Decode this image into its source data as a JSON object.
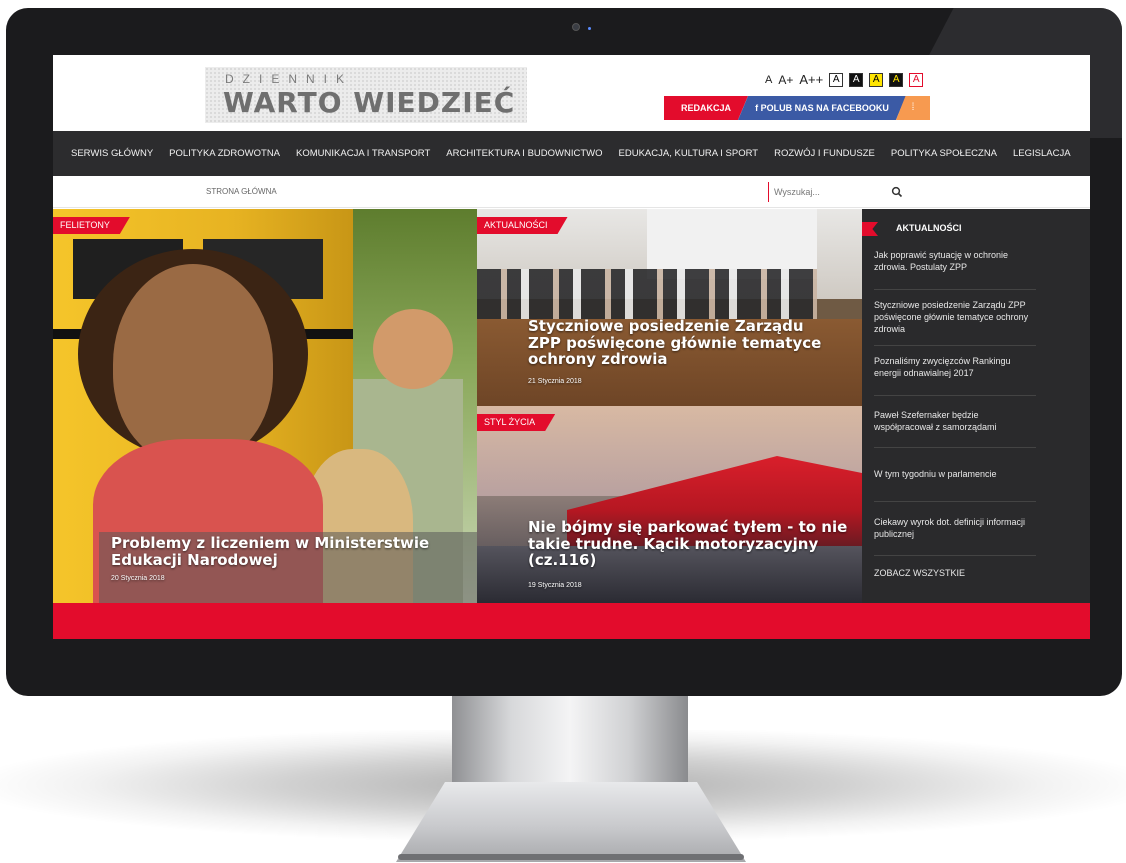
{
  "header": {
    "logo_top": "DZIENNIK",
    "logo_main": "WARTO WIEDZIEĆ",
    "a11y": [
      "A",
      "A+",
      "A++",
      "A",
      "A",
      "A",
      "A",
      "A"
    ],
    "redakcja": "REDAKCJA",
    "facebook": "f POLUB NAS NA FACEBOOKU",
    "rss": "⁞"
  },
  "nav": {
    "items": [
      "SERWIS GŁÓWNY",
      "POLITYKA ZDROWOTNA",
      "KOMUNIKACJA I TRANSPORT",
      "ARCHITEKTURA I BUDOWNICTWO",
      "EDUKACJA, KULTURA I SPORT",
      "ROZWÓJ I FUNDUSZE",
      "POLITYKA SPOŁECZNA",
      "LEGISLACJA"
    ]
  },
  "subbar": {
    "breadcrumb": "STRONA GŁÓWNA",
    "search_placeholder": "Wyszukaj..."
  },
  "cards": [
    {
      "tag": "FELIETONY",
      "title": "Problemy z liczeniem w Ministerstwie Edukacji Narodowej",
      "date": "20 Stycznia 2018"
    },
    {
      "tag": "AKTUALNOŚCI",
      "title": "Styczniowe posiedzenie Zarządu ZPP poświęcone głównie tematyce ochrony zdrowia",
      "date": "21 Stycznia 2018"
    },
    {
      "tag": "STYL ŻYCIA",
      "title": "Nie bójmy się parkować tyłem - to nie takie trudne. Kącik motoryzacyjny (cz.116)",
      "date": "19 Stycznia 2018"
    }
  ],
  "sidebar": {
    "title": "AKTUALNOŚCI",
    "items": [
      "Jak poprawić sytuację w ochronie zdrowia. Postulaty ZPP",
      "Styczniowe posiedzenie Zarządu ZPP poświęcone głównie tematyce ochrony zdrowia",
      "Poznaliśmy zwycięzców Rankingu energii odnawialnej 2017",
      "Paweł Szefernaker będzie współpracował z samorządami",
      "W tym tygodniu w parlamencie",
      "Ciekawy wyrok dot. definicji informacji publicznej"
    ],
    "all": "ZOBACZ WSZYSTKIE"
  },
  "colors": {
    "accent": "#e30c2c",
    "nav_bg": "#2c2c2e",
    "facebook": "#3b5aa5",
    "rss": "#f79a50"
  }
}
